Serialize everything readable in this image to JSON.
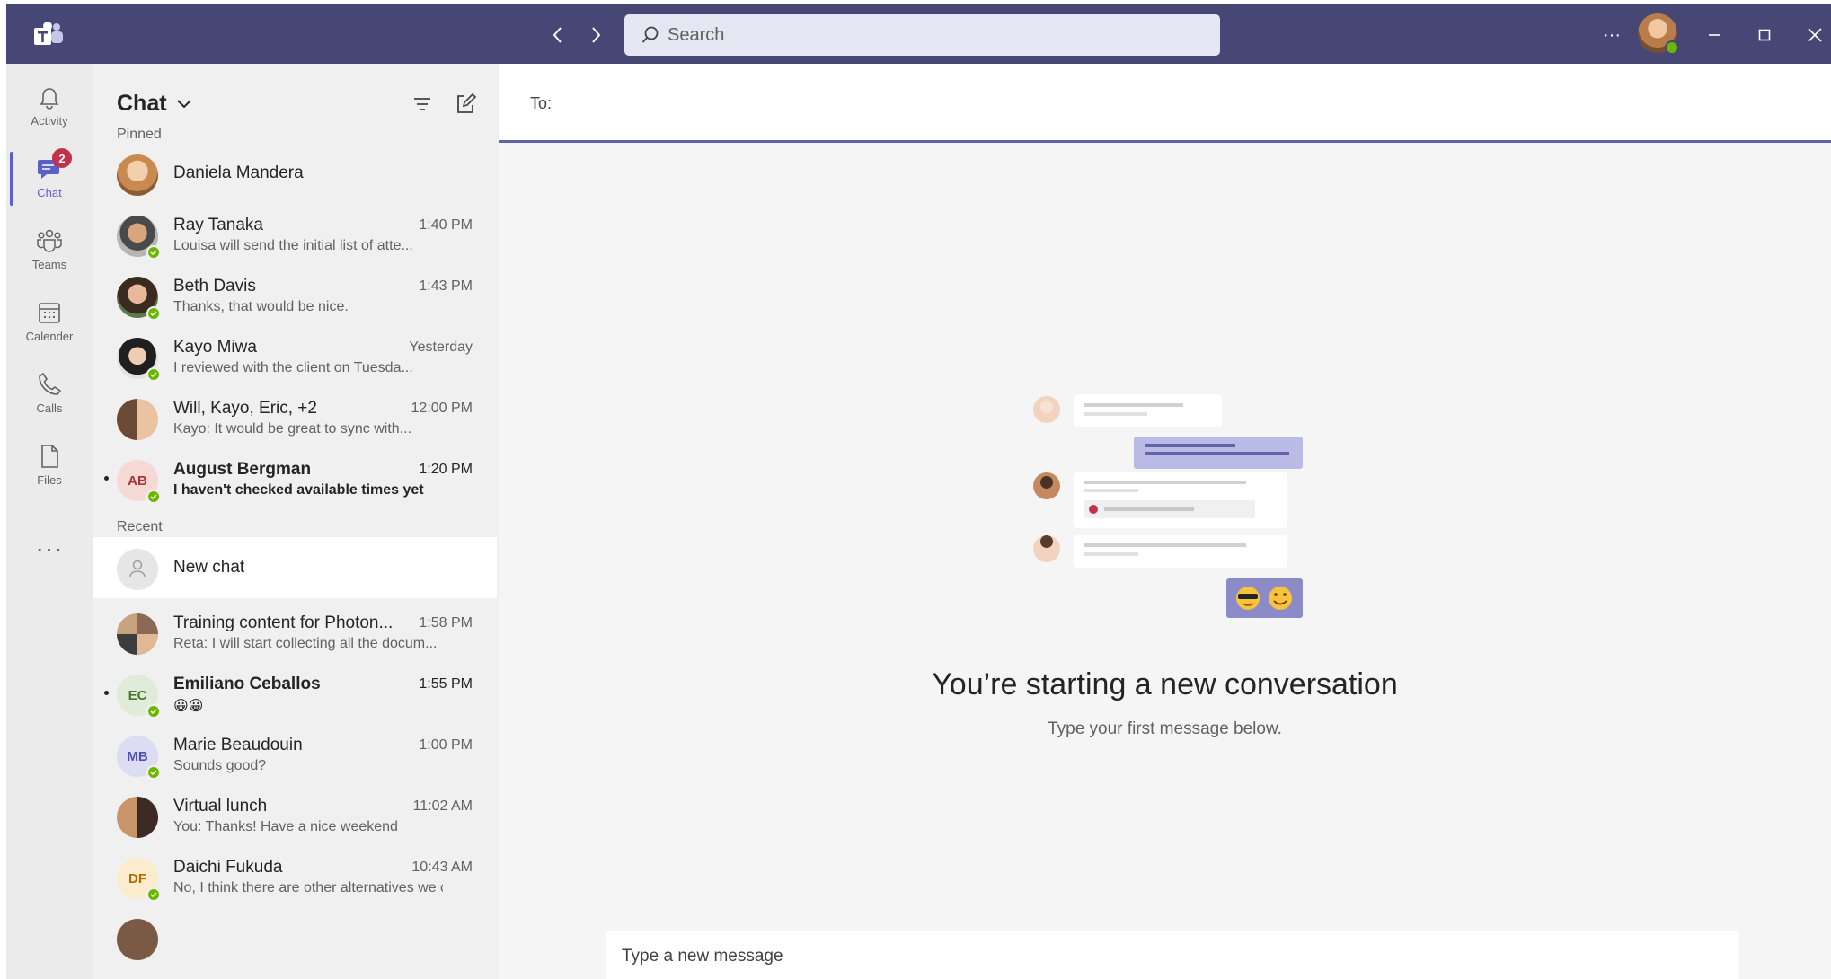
{
  "titlebar": {
    "search_placeholder": "Search",
    "more_label": "···",
    "colors": {
      "bar": "#464775",
      "search_bg": "#e6e6f2"
    }
  },
  "rail": {
    "items": [
      {
        "label": "Activity",
        "icon": "bell-icon"
      },
      {
        "label": "Chat",
        "icon": "chat-icon",
        "badge": "2",
        "active": true
      },
      {
        "label": "Teams",
        "icon": "teams-icon"
      },
      {
        "label": "Calender",
        "icon": "calendar-icon"
      },
      {
        "label": "Calls",
        "icon": "phone-icon"
      },
      {
        "label": "Files",
        "icon": "file-icon"
      }
    ],
    "more_label": "···"
  },
  "chatlist": {
    "title": "Chat",
    "pinned_label": "Pinned",
    "recent_label": "Recent",
    "pinned": [
      {
        "name": "Daniela Mandera",
        "time": "",
        "preview": ""
      },
      {
        "name": "Ray Tanaka",
        "time": "1:40 PM",
        "preview": "Louisa will send the initial list of atte..."
      },
      {
        "name": "Beth Davis",
        "time": "1:43 PM",
        "preview": "Thanks, that would be nice."
      },
      {
        "name": "Kayo Miwa",
        "time": "Yesterday",
        "preview": "I reviewed with the client on Tuesda..."
      },
      {
        "name": "Will, Kayo, Eric, +2",
        "time": "12:00 PM",
        "preview": "Kayo: It would be great to sync with..."
      },
      {
        "name": "August Bergman",
        "initials": "AB",
        "time": "1:20 PM",
        "preview": "I haven't checked available times yet",
        "unread": true
      }
    ],
    "recent": [
      {
        "name": "New chat",
        "time": "",
        "preview": ""
      },
      {
        "name": "Training content for Photon...",
        "time": "1:58 PM",
        "preview": "Reta: I will start collecting all the docum..."
      },
      {
        "name": "Emiliano Ceballos",
        "initials": "EC",
        "time": "1:55 PM",
        "preview": "😀😀",
        "unread": true
      },
      {
        "name": "Marie Beaudouin",
        "initials": "MB",
        "time": "1:00 PM",
        "preview": "Sounds good?"
      },
      {
        "name": "Virtual lunch",
        "time": "11:02 AM",
        "preview": "You: Thanks! Have a nice weekend"
      },
      {
        "name": "Daichi Fukuda",
        "initials": "DF",
        "time": "10:43 AM",
        "preview": "No, I think there are other alternatives we c..."
      }
    ]
  },
  "main": {
    "to_label": "To:",
    "empty_title": "You’re starting a new conversation",
    "empty_subtitle": "Type your first message below.",
    "composer_placeholder": "Type a new message",
    "colors": {
      "accent": "#6264a7",
      "presence": "#6bb700",
      "badge": "#c4314b"
    }
  }
}
